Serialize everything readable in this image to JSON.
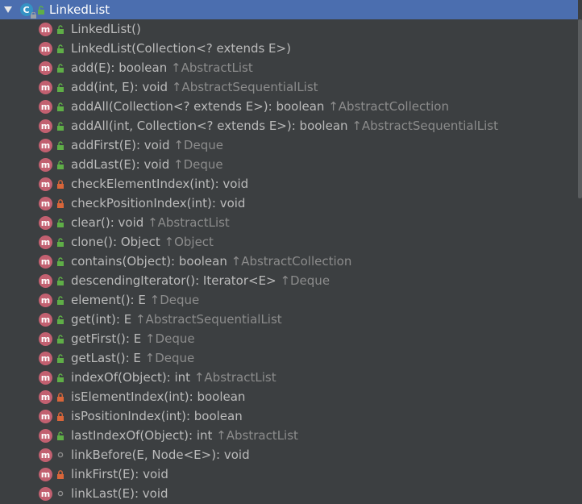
{
  "root": {
    "label": "LinkedList",
    "icon": "class-icon",
    "class_letter": "C",
    "expanded": true
  },
  "method_letter": "m",
  "colors": {
    "selection": "#4b6eaf",
    "background": "#3c3f41",
    "method_icon": "#c26070",
    "public": "#5fae47",
    "private": "#d9663a",
    "package": "#8a8a8a",
    "inherited": "#8c8c8c"
  },
  "members": [
    {
      "sig": "LinkedList()",
      "inherited": "",
      "vis": "public"
    },
    {
      "sig": "LinkedList(Collection<? extends E>)",
      "inherited": "",
      "vis": "public"
    },
    {
      "sig": "add(E): boolean",
      "inherited": "↑AbstractList",
      "vis": "public"
    },
    {
      "sig": "add(int, E): void",
      "inherited": "↑AbstractSequentialList",
      "vis": "public"
    },
    {
      "sig": "addAll(Collection<? extends E>): boolean",
      "inherited": "↑AbstractCollection",
      "vis": "public"
    },
    {
      "sig": "addAll(int, Collection<? extends E>): boolean",
      "inherited": "↑AbstractSequentialList",
      "vis": "public"
    },
    {
      "sig": "addFirst(E): void",
      "inherited": "↑Deque",
      "vis": "public"
    },
    {
      "sig": "addLast(E): void",
      "inherited": "↑Deque",
      "vis": "public"
    },
    {
      "sig": "checkElementIndex(int): void",
      "inherited": "",
      "vis": "private"
    },
    {
      "sig": "checkPositionIndex(int): void",
      "inherited": "",
      "vis": "private"
    },
    {
      "sig": "clear(): void",
      "inherited": "↑AbstractList",
      "vis": "public"
    },
    {
      "sig": "clone(): Object",
      "inherited": "↑Object",
      "vis": "public"
    },
    {
      "sig": "contains(Object): boolean",
      "inherited": "↑AbstractCollection",
      "vis": "public"
    },
    {
      "sig": "descendingIterator(): Iterator<E>",
      "inherited": "↑Deque",
      "vis": "public"
    },
    {
      "sig": "element(): E",
      "inherited": "↑Deque",
      "vis": "public"
    },
    {
      "sig": "get(int): E",
      "inherited": "↑AbstractSequentialList",
      "vis": "public"
    },
    {
      "sig": "getFirst(): E",
      "inherited": "↑Deque",
      "vis": "public"
    },
    {
      "sig": "getLast(): E",
      "inherited": "↑Deque",
      "vis": "public"
    },
    {
      "sig": "indexOf(Object): int",
      "inherited": "↑AbstractList",
      "vis": "public"
    },
    {
      "sig": "isElementIndex(int): boolean",
      "inherited": "",
      "vis": "private"
    },
    {
      "sig": "isPositionIndex(int): boolean",
      "inherited": "",
      "vis": "private"
    },
    {
      "sig": "lastIndexOf(Object): int",
      "inherited": "↑AbstractList",
      "vis": "public"
    },
    {
      "sig": "linkBefore(E, Node<E>): void",
      "inherited": "",
      "vis": "package"
    },
    {
      "sig": "linkFirst(E): void",
      "inherited": "",
      "vis": "private"
    },
    {
      "sig": "linkLast(E): void",
      "inherited": "",
      "vis": "package"
    }
  ]
}
